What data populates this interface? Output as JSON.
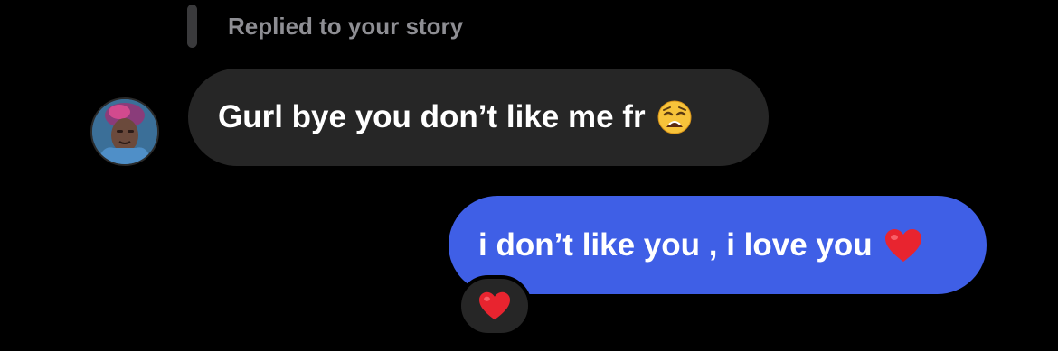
{
  "reply_context": {
    "label": "Replied to your story"
  },
  "messages": [
    {
      "direction": "incoming",
      "text": "Gurl bye you don’t like me fr",
      "emoji": "weary-face-emoji",
      "has_avatar": true
    },
    {
      "direction": "outgoing",
      "text": "i don’t like you , i love you",
      "emoji": "red-heart-emoji",
      "reaction": "red-heart-emoji"
    }
  ],
  "colors": {
    "background": "#000000",
    "incoming_bubble": "#262626",
    "outgoing_bubble": "#3f5fe6",
    "reply_label": "#8e8e93",
    "heart": "#e8242f"
  }
}
